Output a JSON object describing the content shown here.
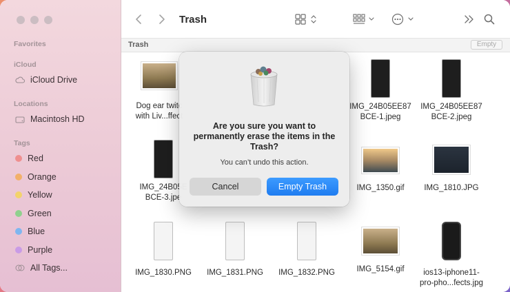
{
  "window": {
    "title": "Trash"
  },
  "sidebar": {
    "sections": [
      {
        "label": "Favorites"
      },
      {
        "label": "iCloud"
      },
      {
        "label": "Locations"
      },
      {
        "label": "Tags"
      }
    ],
    "icloud_items": [
      {
        "label": "iCloud Drive",
        "icon": "cloud-icon"
      }
    ],
    "location_items": [
      {
        "label": "Macintosh HD",
        "icon": "disk-icon"
      }
    ],
    "tags": [
      {
        "label": "Red",
        "color": "#ef8f8f"
      },
      {
        "label": "Orange",
        "color": "#f2b06a"
      },
      {
        "label": "Yellow",
        "color": "#f3d36b"
      },
      {
        "label": "Green",
        "color": "#8fd18e"
      },
      {
        "label": "Blue",
        "color": "#7fb6f0"
      },
      {
        "label": "Purple",
        "color": "#c99be6"
      }
    ],
    "all_tags": "All Tags..."
  },
  "toolbar": {
    "back_icon": "chevron-left-icon",
    "forward_icon": "chevron-right-icon",
    "title": "Trash",
    "view_icon": "grid-view-icon",
    "group_icon": "group-icon",
    "action_icon": "ellipsis-circle-icon",
    "more_icon": "double-chevron-icon",
    "search_icon": "search-icon"
  },
  "pathbar": {
    "title": "Trash",
    "empty_label": "Empty"
  },
  "files": [
    {
      "name_line1": "Dog ear twitc",
      "name_line2": "with Liv...ffect"
    },
    {
      "name_line1": "IMG_24B05EE87",
      "name_line2": "BCE-1.jpeg"
    },
    {
      "name_line1": "IMG_24B05EE87",
      "name_line2": "BCE-2.jpeg"
    },
    {
      "name_line1": "IMG_24B05E",
      "name_line2": "BCE-3.jpe"
    },
    {
      "name_line1": "IMG_1350.gif",
      "name_line2": ""
    },
    {
      "name_line1": "IMG_1810.JPG",
      "name_line2": ""
    },
    {
      "name_line1": "IMG_1830.PNG",
      "name_line2": ""
    },
    {
      "name_line1": "IMG_1831.PNG",
      "name_line2": ""
    },
    {
      "name_line1": "IMG_1832.PNG",
      "name_line2": ""
    },
    {
      "name_line1": "IMG_5154.gif",
      "name_line2": ""
    },
    {
      "name_line1": "ios13-iphone11-",
      "name_line2": "pro-pho...fects.jpg"
    }
  ],
  "dialog": {
    "icon": "trash-full-icon",
    "title": "Are you sure you want to permanently erase the items in the Trash?",
    "message": "You can’t undo this action.",
    "cancel_label": "Cancel",
    "confirm_label": "Empty Trash"
  }
}
